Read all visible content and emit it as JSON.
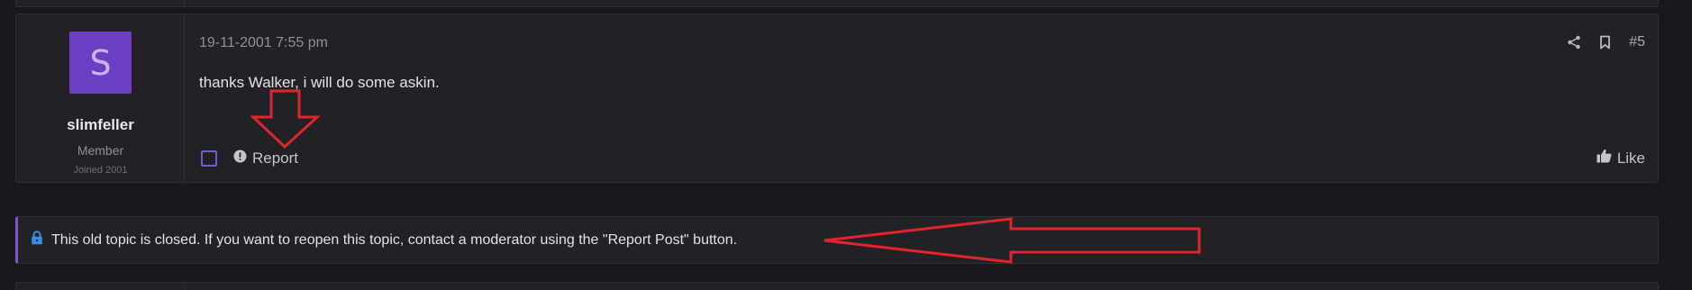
{
  "post": {
    "user": {
      "avatar_letter": "S",
      "avatar_color": "#6a3fc4",
      "username": "slimfeller",
      "role": "Member",
      "joined": "Joined 2001"
    },
    "date": "19-11-2001 7:55 pm",
    "share_icon": "share-icon",
    "bookmark_icon": "bookmark-icon",
    "post_number": "#5",
    "body": "thanks Walker, i will do some askin.",
    "report_label": "Report",
    "like_label": "Like"
  },
  "notice": {
    "icon": "lock-icon",
    "text": "This old topic is closed. If you want to reopen this topic, contact a moderator using the \"Report Post\" button."
  },
  "colors": {
    "accent": "#7b56d8",
    "annotation": "#e0252d",
    "background": "#19191d",
    "panel": "#222226"
  }
}
